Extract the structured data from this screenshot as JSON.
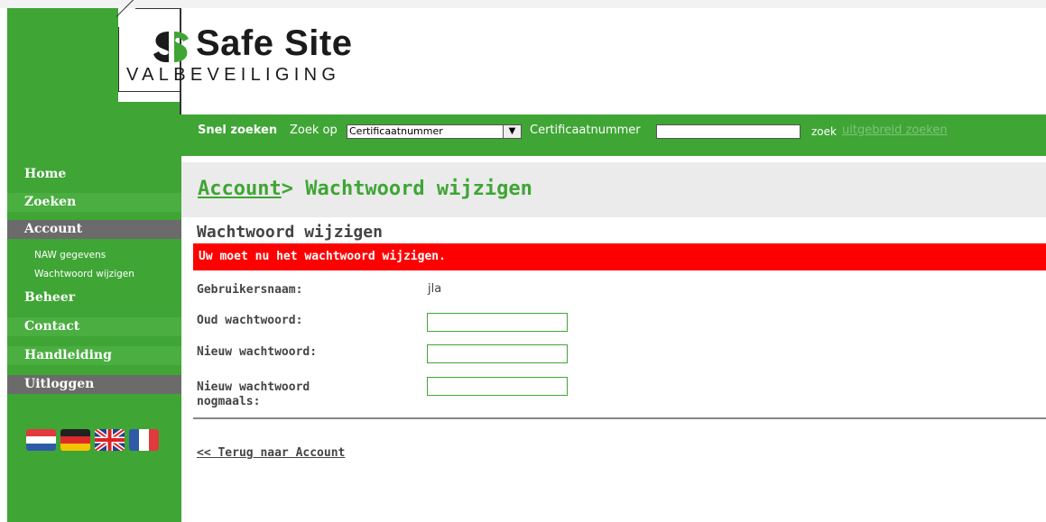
{
  "logo": {
    "title": "Safe Site",
    "subtitle": "VALBEVEILIGING"
  },
  "search": {
    "label_bold": "Snel zoeken",
    "label_zoek_op": "Zoek op",
    "select_value": "Certificaatnummer",
    "field_label": "Certificaatnummer",
    "input_value": "",
    "zoek_label": "zoek",
    "advanced_label": "uitgebreid zoeken"
  },
  "nav": {
    "home": "Home",
    "zoeken": "Zoeken",
    "account": "Account",
    "sub_naw": "NAW gegevens",
    "sub_wachtwoord": "Wachtwoord wijzigen",
    "beheer": "Beheer",
    "contact": "Contact",
    "handleiding": "Handleiding",
    "uitloggen": "Uitloggen"
  },
  "flags": [
    "netherlands-flag-icon",
    "germany-flag-icon",
    "uk-flag-icon",
    "france-flag-icon"
  ],
  "main": {
    "breadcrumb_link": "Account",
    "breadcrumb_rest": "> Wachtwoord wijzigen",
    "subheading": "Wachtwoord wijzigen",
    "alert": "Uw moet nu het wachtwoord wijzigen.",
    "username_label": "Gebruikersnaam:",
    "username_value": "jla",
    "old_password_label": "Oud wachtwoord:",
    "new_password_label": "Nieuw wachtwoord:",
    "new_password_again_line1": "Nieuw wachtwoord",
    "new_password_again_line2": "nogmaals:",
    "back_link": "<< Terug naar Account"
  },
  "colors": {
    "brand_green": "#3fa535",
    "alert_red": "#ff0000",
    "active_nav_gray": "#6b6b6b"
  }
}
